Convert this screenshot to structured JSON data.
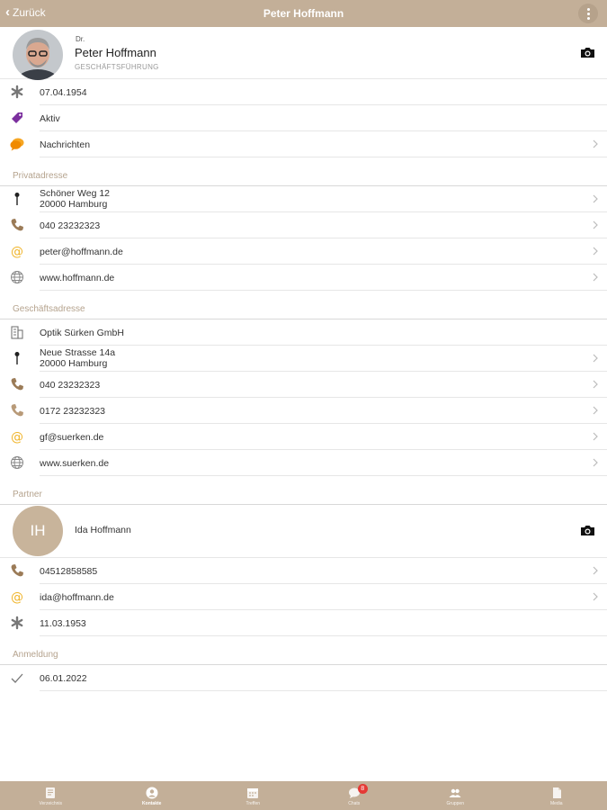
{
  "header": {
    "back_label": "Zurück",
    "title": "Peter Hoffmann"
  },
  "profile": {
    "title": "Dr.",
    "name": "Peter Hoffmann",
    "role": "GESCHÄFTSFÜHRUNG"
  },
  "details": [
    {
      "icon": "asterisk-icon",
      "text": "07.04.1954"
    },
    {
      "icon": "tag-icon",
      "text": "Aktiv"
    },
    {
      "icon": "chat-icon",
      "text": "Nachrichten"
    }
  ],
  "private": {
    "heading": "Privatadresse",
    "street": "Schöner Weg 12",
    "city": "20000 Hamburg",
    "phone": "040 23232323",
    "email": "peter@hoffmann.de",
    "web": "www.hoffmann.de"
  },
  "business": {
    "heading": "Geschäftsadresse",
    "company": "Optik Sürken GmbH",
    "street": "Neue Strasse 14a",
    "city": "20000 Hamburg",
    "phone": "040 23232323",
    "mobile": "0172 23232323",
    "email": "gf@suerken.de",
    "web": "www.suerken.de"
  },
  "partner": {
    "heading": "Partner",
    "initials": "IH",
    "name": "Ida Hoffmann",
    "phone": "04512858585",
    "email": "ida@hoffmann.de",
    "birthday": "11.03.1953"
  },
  "registration": {
    "heading": "Anmeldung",
    "date": "06.01.2022"
  },
  "tabs": [
    {
      "label": "Verzeichnis"
    },
    {
      "label": "Kontakte"
    },
    {
      "label": "Treffen"
    },
    {
      "label": "Chats",
      "badge": "8"
    },
    {
      "label": "Gruppen"
    },
    {
      "label": "Media"
    }
  ],
  "colors": {
    "accent": "#c3af98",
    "phone_icon": "#9b7b57",
    "email_icon": "#f0b429",
    "tag_icon": "#7b2f9e",
    "chat_icon": "#f08a00",
    "badge": "#e53935"
  }
}
